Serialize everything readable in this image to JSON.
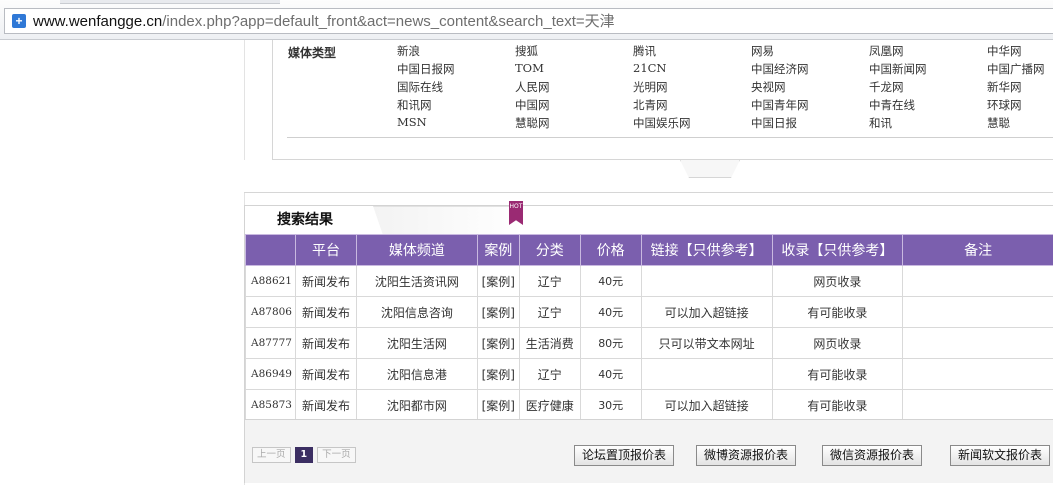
{
  "browser": {
    "url_host": "www.wenfangge.cn",
    "url_path": "/index.php?app=default_front&act=news_content&search_text=天津"
  },
  "media_panel": {
    "label": "媒体类型",
    "items": [
      "新浪",
      "搜狐",
      "腾讯",
      "网易",
      "凤凰网",
      "中华网",
      "中国日报网",
      "TOM",
      "21CN",
      "中国经济网",
      "中国新闻网",
      "中国广播网",
      "国际在线",
      "人民网",
      "光明网",
      "央视网",
      "千龙网",
      "新华网",
      "和讯网",
      "中国网",
      "北青网",
      "中国青年网",
      "中青在线",
      "环球网",
      "MSN",
      "慧聪网",
      "中国娱乐网",
      "中国日报",
      "和讯",
      "慧聪"
    ]
  },
  "results": {
    "tab_title": "搜索结果",
    "hot_label": "HOT",
    "columns": [
      "",
      "平台",
      "媒体频道",
      "案例",
      "分类",
      "价格",
      "链接【只供参考】",
      "收录【只供参考】",
      "备注"
    ],
    "rows": [
      {
        "id": "A88621",
        "platform": "新闻发布",
        "channel": "沈阳生活资讯网",
        "case": "[案例]",
        "category": "辽宁",
        "price": "40元",
        "link": "",
        "index": "网页收录",
        "note": ""
      },
      {
        "id": "A87806",
        "platform": "新闻发布",
        "channel": "沈阳信息咨询",
        "case": "[案例]",
        "category": "辽宁",
        "price": "40元",
        "link": "可以加入超链接",
        "index": "有可能收录",
        "note": ""
      },
      {
        "id": "A87777",
        "platform": "新闻发布",
        "channel": "沈阳生活网",
        "case": "[案例]",
        "category": "生活消费",
        "price": "80元",
        "link": "只可以带文本网址",
        "index": "网页收录",
        "note": ""
      },
      {
        "id": "A86949",
        "platform": "新闻发布",
        "channel": "沈阳信息港",
        "case": "[案例]",
        "category": "辽宁",
        "price": "40元",
        "link": "",
        "index": "有可能收录",
        "note": ""
      },
      {
        "id": "A85873",
        "platform": "新闻发布",
        "channel": "沈阳都市网",
        "case": "[案例]",
        "category": "医疗健康",
        "price": "30元",
        "link": "可以加入超链接",
        "index": "有可能收录",
        "note": ""
      }
    ]
  },
  "pager": {
    "prev": "上一页",
    "current": "1",
    "next": "下一页"
  },
  "price_buttons": [
    "论坛置顶报价表",
    "微博资源报价表",
    "微信资源报价表",
    "新闻软文报价表"
  ],
  "colors": {
    "header_purple": "#7b5fae",
    "current_page": "#3b2e62",
    "hot_tag": "#9a2a73"
  }
}
